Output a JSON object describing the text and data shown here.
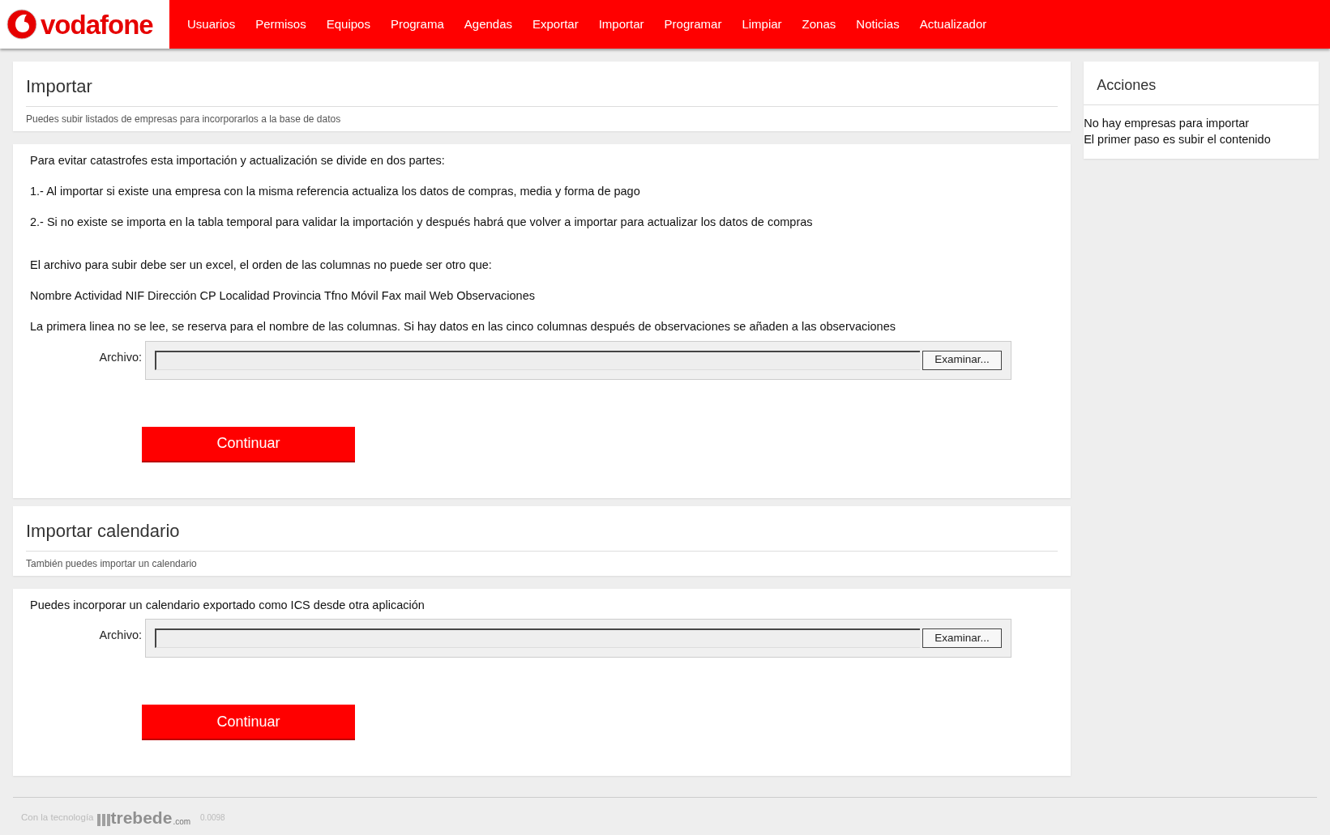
{
  "brand": {
    "name": "vodafone"
  },
  "nav": [
    "Usuarios",
    "Permisos",
    "Equipos",
    "Programa",
    "Agendas",
    "Exportar",
    "Importar",
    "Programar",
    "Limpiar",
    "Zonas",
    "Noticias",
    "Actualizador"
  ],
  "sections": [
    {
      "title": "Importar",
      "subtitle": "Puedes subir listados de empresas para incorporarlos a la base de datos",
      "paragraph_groups": [
        [
          "Para evitar catastrofes esta importación y actualización se divide en dos partes:",
          "1.- Al importar si existe una empresa con la misma referencia actualiza los datos de compras, media y forma de pago",
          "2.- Si no existe se importa en la tabla temporal para validar la importación y después habrá que volver a importar para actualizar los datos de compras"
        ],
        [
          "El archivo para subir debe ser un excel, el orden de las columnas no puede ser otro que:",
          "Nombre Actividad NIF Dirección CP Localidad Provincia Tfno Móvil Fax mail Web Observaciones",
          "La primera linea no se lee, se reserva para el nombre de las columnas. Si hay datos en las cinco columnas después de observaciones se añaden a las observaciones"
        ]
      ],
      "file_field": {
        "label": "Archivo:",
        "button": "Examinar..."
      },
      "submit": "Continuar"
    },
    {
      "title": "Importar calendario",
      "subtitle": "También puedes importar un calendario",
      "paragraph_groups": [
        [
          "Puedes incorporar un calendario exportado como ICS desde otra aplicación"
        ]
      ],
      "file_field": {
        "label": "Archivo:",
        "button": "Examinar..."
      },
      "submit": "Continuar"
    }
  ],
  "sidebar": {
    "title": "Acciones",
    "lines": [
      "No hay empresas para importar",
      "El primer paso es subir el contenido"
    ]
  },
  "footer": {
    "text": "Con la tecnología",
    "logo": "trebede",
    "logo_suffix": ".com",
    "version": "0.0098"
  }
}
